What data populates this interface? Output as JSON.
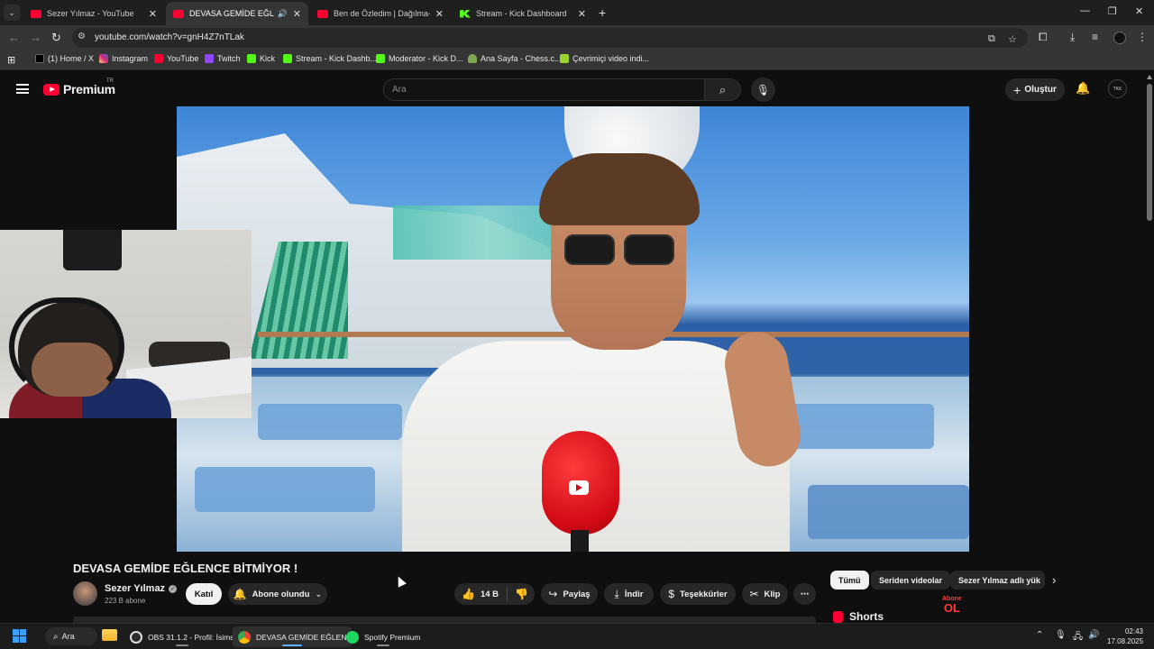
{
  "browser": {
    "tabs": [
      {
        "title": "Sezer Yılmaz - YouTube",
        "icon": "youtube-icon",
        "active": false
      },
      {
        "title": "DEVASA GEMİDE EĞLENCE",
        "icon": "youtube-icon",
        "active": true,
        "audio": true
      },
      {
        "title": "Ben de Özledim | Dağılma-Elek",
        "icon": "youtube-icon",
        "active": false
      },
      {
        "title": "Stream - Kick Dashboard",
        "icon": "kick-icon",
        "active": false
      }
    ],
    "url": "youtube.com/watch?v=gnH4Z7nTLak",
    "bookmarks": [
      {
        "label": "(1) Home / X",
        "icon": "x-icon"
      },
      {
        "label": "Instagram",
        "icon": "instagram-icon"
      },
      {
        "label": "YouTube",
        "icon": "youtube-icon"
      },
      {
        "label": "Twitch",
        "icon": "twitch-icon"
      },
      {
        "label": "Kick",
        "icon": "kick-icon"
      },
      {
        "label": "Stream - Kick Dashb...",
        "icon": "kick-icon"
      },
      {
        "label": "Moderator - Kick D...",
        "icon": "kick-icon"
      },
      {
        "label": "Ana Sayfa - Chess.c...",
        "icon": "chess-icon"
      },
      {
        "label": "Çevrimiçi video indi...",
        "icon": "download-icon"
      }
    ]
  },
  "youtube": {
    "logo_text": "Premium",
    "country_code": "TR",
    "search_placeholder": "Ara",
    "create_label": "Oluştur",
    "avatar_text": "TKK",
    "watermark_top": "Abone",
    "watermark_bottom": "OL",
    "video": {
      "title": "DEVASA GEMİDE EĞLENCE BİTMİYOR !",
      "channel": "Sezer Yılmaz",
      "subscribers": "223 B abone",
      "join_label": "Katıl",
      "subscribed_label": "Abone olundu",
      "likes": "14 B",
      "share_label": "Paylaş",
      "download_label": "İndir",
      "thanks_label": "Teşekkürler",
      "clip_label": "Klip"
    },
    "chips": [
      "Tümü",
      "Seriden videolar",
      "Sezer Yılmaz adlı yük"
    ],
    "shorts_label": "Shorts"
  },
  "taskbar": {
    "search_label": "Ara",
    "apps": [
      {
        "label": "OBS 31.1.2 - Profil: İsims",
        "icon": "obs-icon"
      },
      {
        "label": "DEVASA GEMİDE EĞLEN",
        "icon": "chrome-icon",
        "active": true
      },
      {
        "label": "Spotify Premium",
        "icon": "spotify-icon"
      }
    ],
    "time": "02:43",
    "date": "17.08.2025"
  },
  "colors": {
    "youtube_red": "#ff0033",
    "kick_green": "#53fc18",
    "background": "#0f0f0f"
  }
}
